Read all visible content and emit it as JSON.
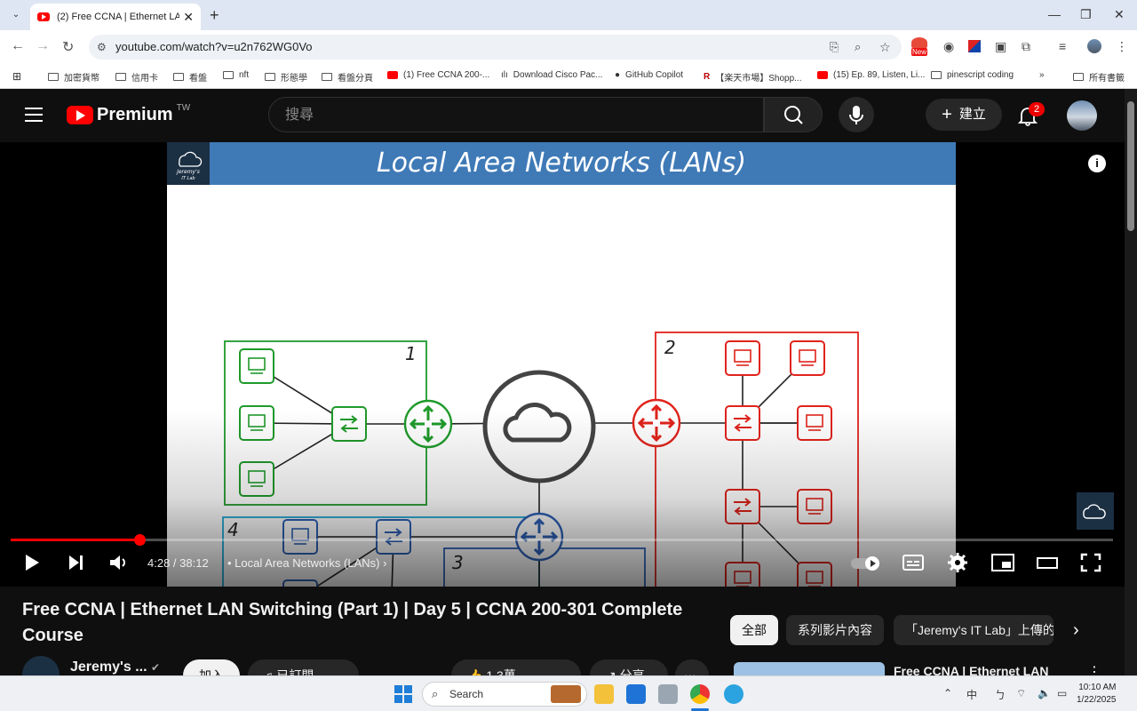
{
  "browser": {
    "tab_title": "(2) Free CCNA | Ethernet LAN S",
    "url": "youtube.com/watch?v=u2n762WG0Vo",
    "bookmarks": [
      "加密貨幣",
      "信用卡",
      "看盤",
      "nft",
      "形態學",
      "看盤分頁",
      "(1) Free CCNA 200-...",
      "Download Cisco Pac...",
      "GitHub Copilot",
      "【楽天市場】Shopp...",
      "(15) Ep. 89, Listen, Li...",
      "pinescript coding",
      "所有書籤"
    ],
    "ext_new_badge": "New"
  },
  "youtube": {
    "logo_text": "Premium",
    "region": "TW",
    "search_placeholder": "搜尋",
    "create_label": "建立",
    "notification_count": "2"
  },
  "player": {
    "slide_title": "Local Area Networks (LANs)",
    "slide_logo_line1": "Jeremy's",
    "slide_logo_line2": "IT Lab",
    "lan_labels": [
      "1",
      "2",
      "3",
      "4"
    ],
    "time": "4:28 / 38:12",
    "chapter": "Local Area Networks (LANs)",
    "progress": 0.117
  },
  "below": {
    "video_title": "Free CCNA | Ethernet LAN Switching (Part 1) | Day 5 | CCNA 200-301 Complete Course",
    "chips": [
      "全部",
      "系列影片內容",
      "「Jeremy's IT Lab」上傳的"
    ],
    "channel_name": "Jeremy's ...",
    "join_label": "加入",
    "subscribed_label": "已訂閱",
    "likes": "1.3萬",
    "share_label": "分享",
    "rec_title": "Free CCNA | Ethernet LAN"
  },
  "taskbar": {
    "search_label": "Search",
    "time": "10:10 AM",
    "date": "1/22/2025",
    "ime": "中"
  },
  "colors": {
    "lan1": "#1f9a2a",
    "lan2": "#e0231b",
    "lan34": "#2e62b8",
    "lan4_frame": "#1aa8d8"
  }
}
